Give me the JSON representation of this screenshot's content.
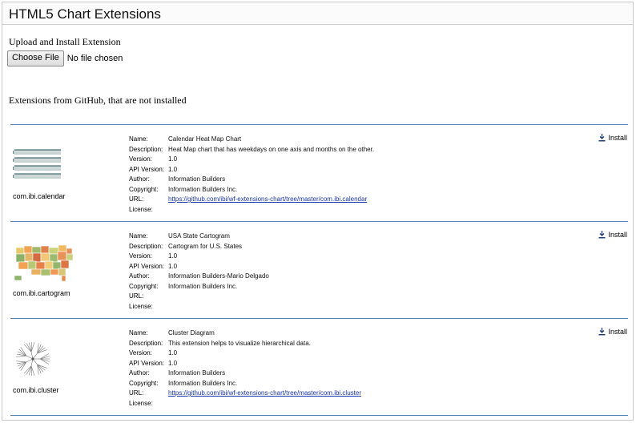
{
  "page": {
    "title": "HTML5 Chart Extensions"
  },
  "upload": {
    "label": "Upload and Install Extension",
    "choose_button": "Choose File",
    "status": "No file chosen"
  },
  "github": {
    "heading": "Extensions from GitHub, that are not installed"
  },
  "field_labels": {
    "name": "Name:",
    "description": "Description:",
    "version": "Version:",
    "api_version": "API Version:",
    "author": "Author:",
    "copyright": "Copyright:",
    "url": "URL:",
    "license": "License:"
  },
  "install_label": "Install",
  "extensions": [
    {
      "id": "com.ibi.calendar",
      "thumbnail_icon": "calendar-heatmap-thumbnail",
      "name": "Calendar Heat Map Chart",
      "description": "Heat Map chart that has weekdays on one axis and months on the other.",
      "version": "1.0",
      "api_version": "1.0",
      "author": "Information Builders",
      "copyright": "Information Builders Inc.",
      "url": "https://github.com/ibi/wf-extensions-chart/tree/master/com.ibi.calendar",
      "license": ""
    },
    {
      "id": "com.ibi.cartogram",
      "thumbnail_icon": "usa-cartogram-thumbnail",
      "name": "USA State Cartogram",
      "description": "Cartogram for U.S. States",
      "version": "1.0",
      "api_version": "1.0",
      "author": "Information Builders-Mario Delgado",
      "copyright": "Information Builders Inc.",
      "url": "",
      "license": ""
    },
    {
      "id": "com.ibi.cluster",
      "thumbnail_icon": "cluster-dendrogram-thumbnail",
      "name": "Cluster Diagram",
      "description": "This extension helps to visualize hierarchical data.",
      "version": "1.0",
      "api_version": "1.0",
      "author": "Information Builders",
      "copyright": "Information Builders Inc.",
      "url": "https://github.com/ibi/wf-extensions-chart/tree/master/com.ibi.cluster",
      "license": ""
    }
  ],
  "colors": {
    "divider": "#5c7fb8",
    "link": "#1a35b0"
  }
}
